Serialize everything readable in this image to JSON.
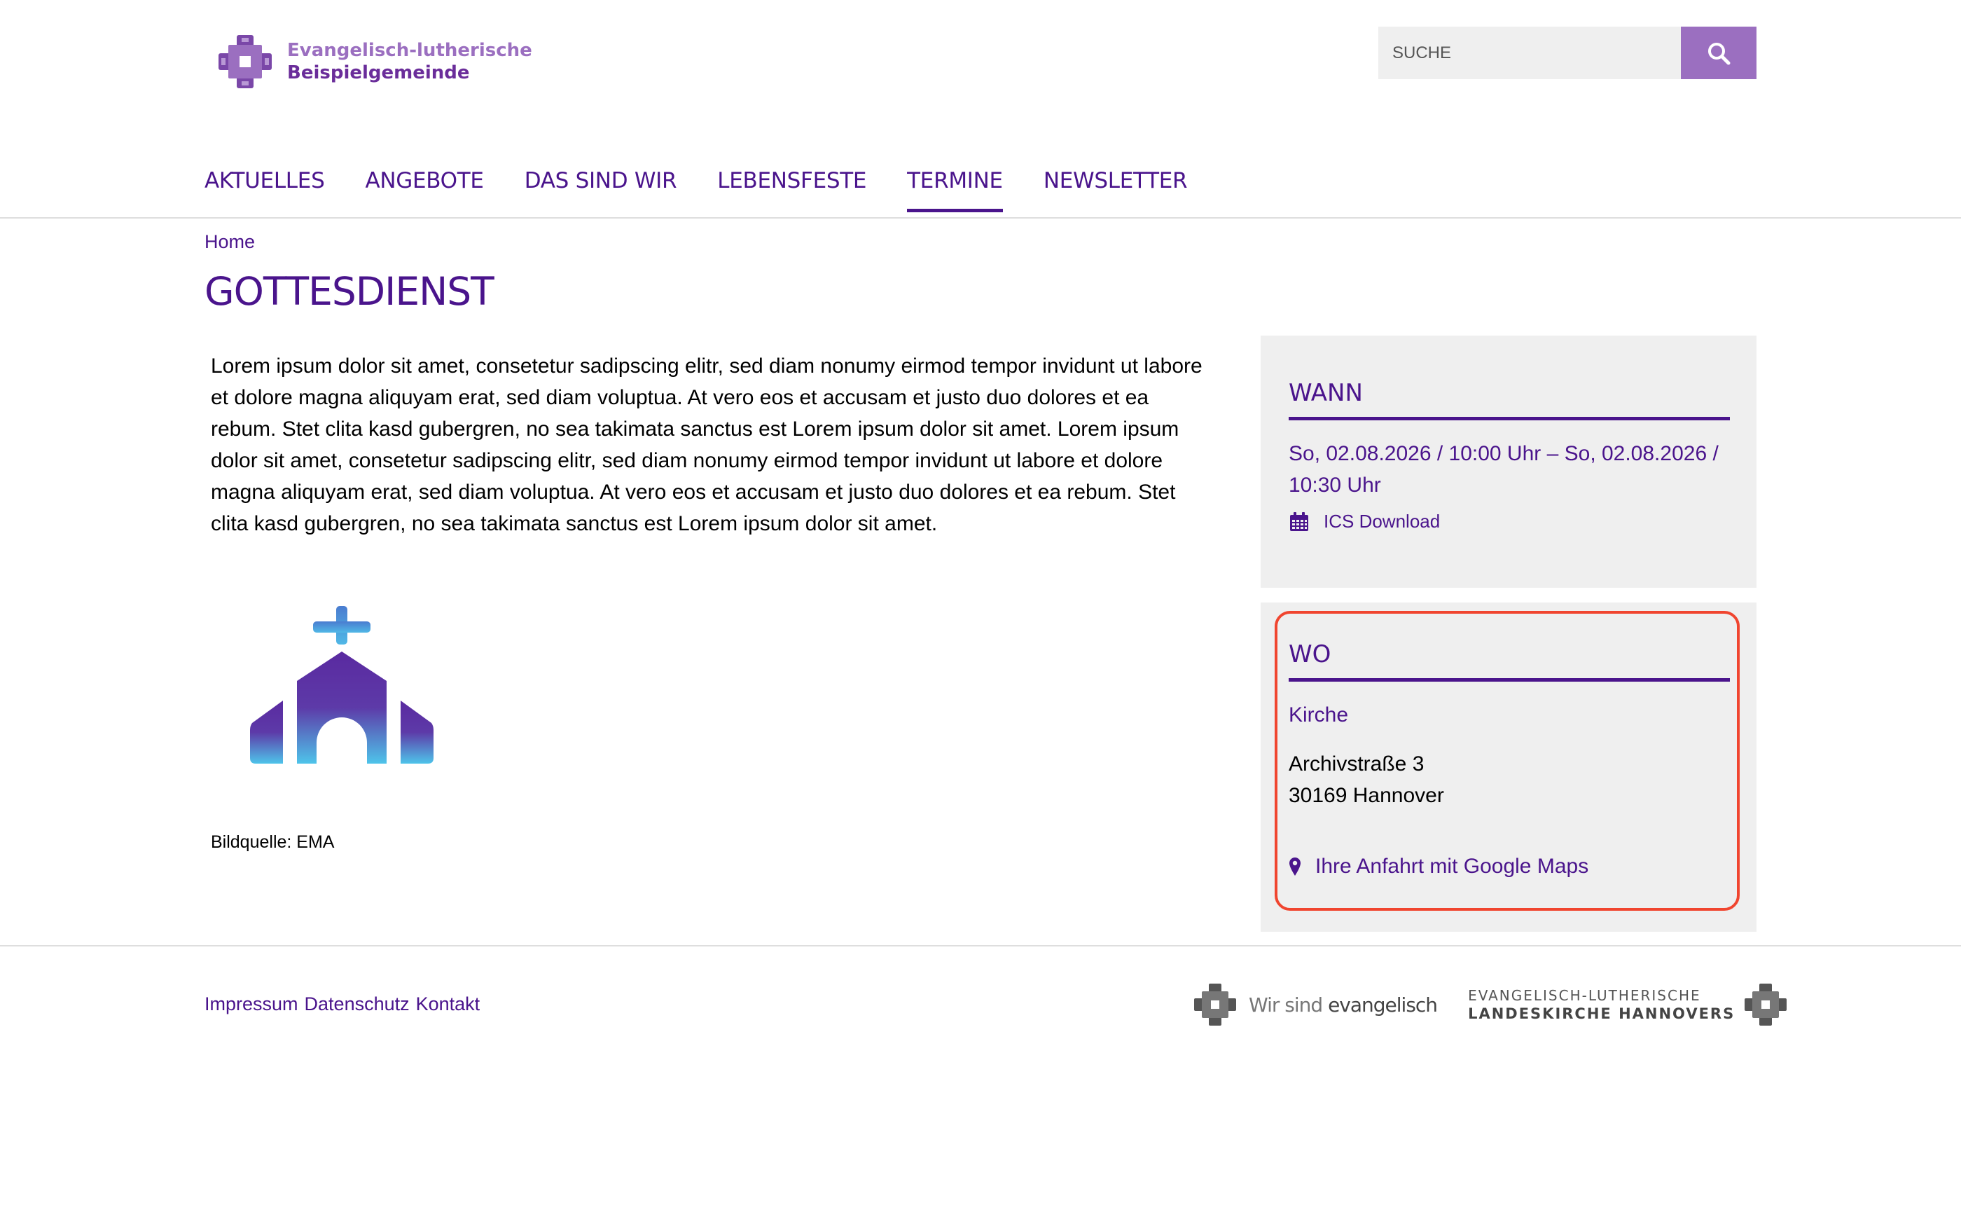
{
  "header": {
    "logo_line1": "Evangelisch-lutherische",
    "logo_line2": "Beispielgemeinde",
    "search_placeholder": "SUCHE"
  },
  "nav": {
    "items": [
      {
        "label": "AKTUELLES"
      },
      {
        "label": "ANGEBOTE"
      },
      {
        "label": "DAS SIND WIR"
      },
      {
        "label": "LEBENSFESTE"
      },
      {
        "label": "TERMINE",
        "active": true
      },
      {
        "label": "NEWSLETTER"
      }
    ]
  },
  "breadcrumb": "Home",
  "page_title": "GOTTESDIENST",
  "main": {
    "text": "Lorem ipsum dolor sit amet, consetetur sadipscing elitr, sed diam nonumy eirmod tempor invidunt ut labore et dolore magna aliquyam erat, sed diam voluptua. At vero eos et accusam et justo duo dolores et ea rebum. Stet clita kasd gubergren, no sea takimata sanctus est Lorem ipsum dolor sit amet. Lorem ipsum dolor sit amet, consetetur sadipscing elitr, sed diam nonumy eirmod tempor invidunt ut labore et dolore magna aliquyam erat, sed diam voluptua. At vero eos et accusam et justo duo dolores et ea rebum. Stet clita kasd gubergren, no sea takimata sanctus est Lorem ipsum dolor sit amet.",
    "image_caption": "Bildquelle: EMA"
  },
  "when": {
    "heading": "WANN",
    "date": "So, 02.08.2026 / 10:00 Uhr – So, 02.08.2026 / 10:30 Uhr",
    "ics_label": "ICS Download"
  },
  "where": {
    "heading": "WO",
    "name": "Kirche",
    "street": "Archivstraße 3",
    "city": "30169 Hannover",
    "maps_label": "Ihre Anfahrt mit Google Maps"
  },
  "footer": {
    "links": [
      "Impressum",
      "Datenschutz",
      "Kontakt"
    ],
    "logo1_a": "Wir sind ",
    "logo1_b": "evangelisch",
    "logo2_line1": "EVANGELISCH-LUTHERISCHE",
    "logo2_line2": "LANDESKIRCHE HANNOVERS"
  },
  "colors": {
    "primary": "#4a148c",
    "accent": "#9b6fc0",
    "box_bg": "#efefef",
    "highlight": "#f0452f"
  }
}
